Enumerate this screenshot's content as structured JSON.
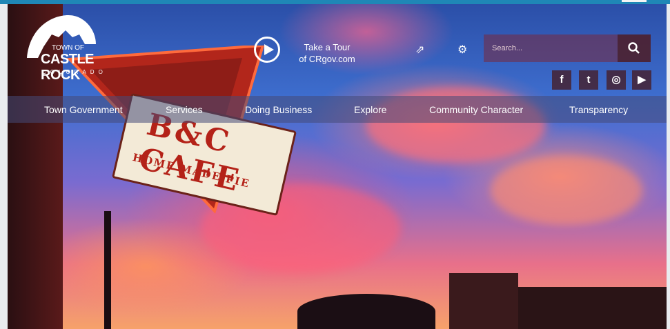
{
  "logo": {
    "small": "TOWN OF",
    "big": "CASTLE ROCK",
    "sub": "COLORADO"
  },
  "sign": {
    "line1": "B&C CAFE",
    "line2": "HOME MADE PIE"
  },
  "tour": {
    "line1": "Take a Tour",
    "line2": "of CRgov.com"
  },
  "search": {
    "placeholder": "Search..."
  },
  "icons": {
    "share": "share-icon",
    "settings": "gear-icon",
    "search": "search-icon"
  },
  "social": [
    {
      "label": "f",
      "icon": "facebook-icon"
    },
    {
      "label": "t",
      "icon": "twitter-icon"
    },
    {
      "label": "◎",
      "icon": "instagram-icon"
    },
    {
      "label": "▶",
      "icon": "youtube-icon"
    }
  ],
  "nav": [
    "Town Government",
    "Services",
    "Doing Business",
    "Explore",
    "Community Character",
    "Transparency"
  ],
  "colors": {
    "topbar": "#1f87b6",
    "nav_bg": "rgba(70,75,120,0.55)",
    "sign_red": "#b42218"
  }
}
